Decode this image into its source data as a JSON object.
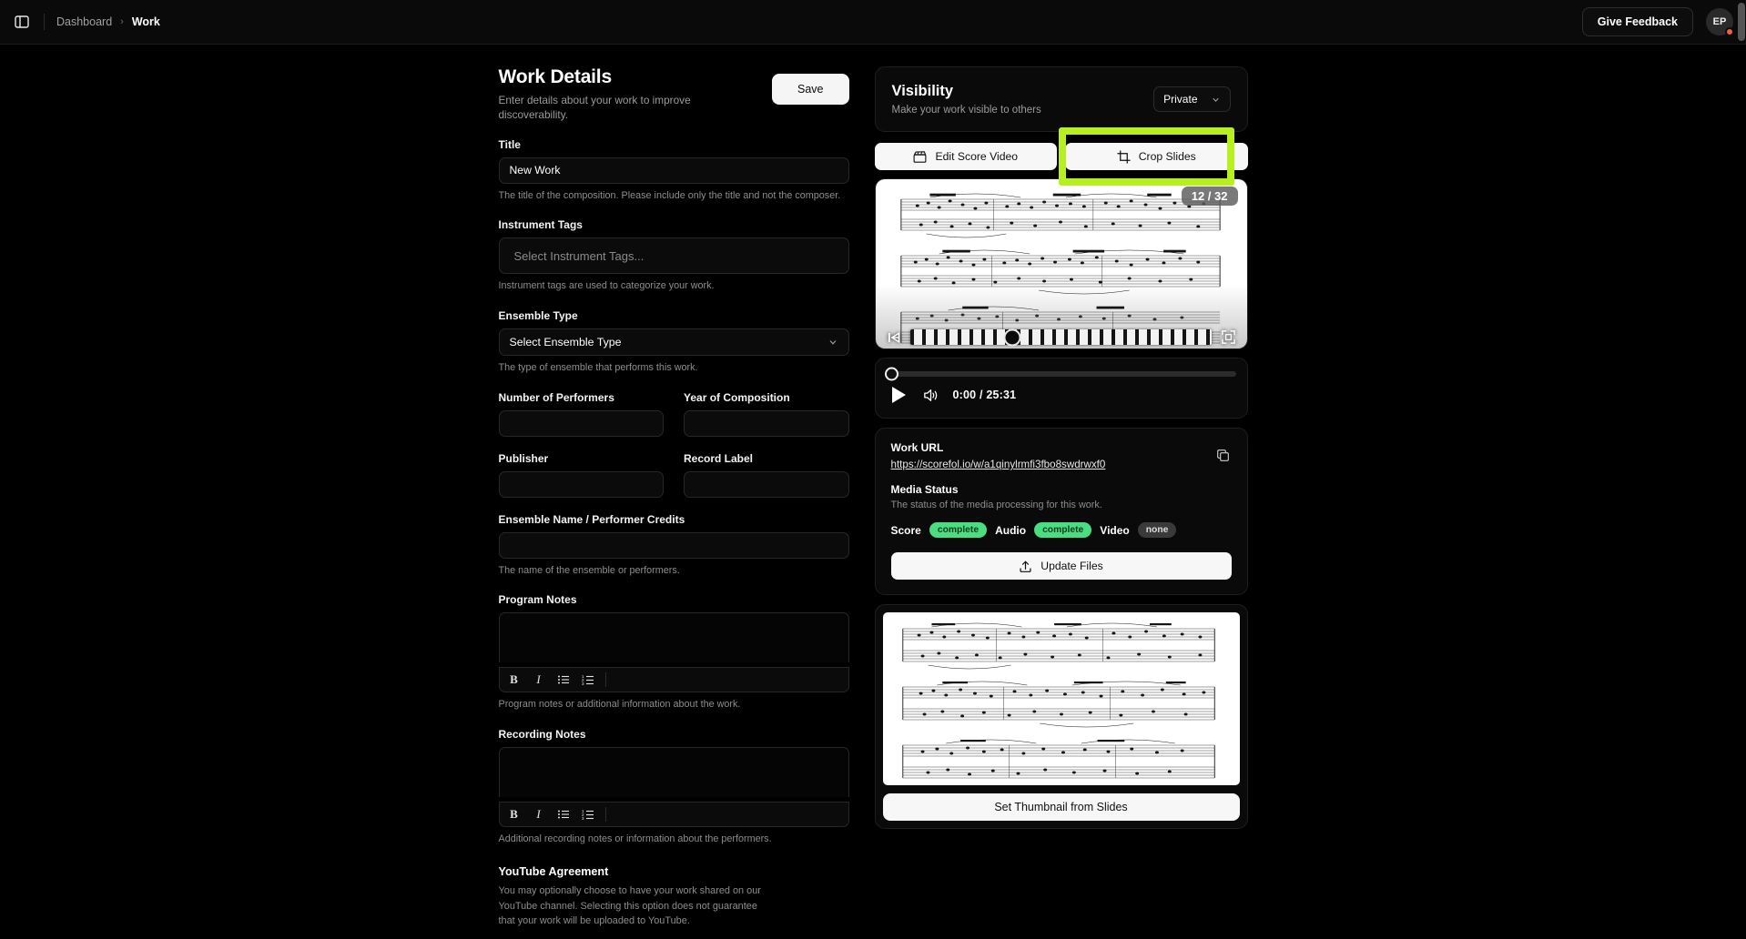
{
  "topbar": {
    "panel_toggle_icon": "sidebar-panel-icon",
    "breadcrumb": {
      "parent": "Dashboard",
      "separator": "›",
      "current": "Work"
    },
    "feedback_label": "Give Feedback",
    "avatar_initials": "EP"
  },
  "work_details": {
    "title": "Work Details",
    "subtitle": "Enter details about your work to improve discoverability.",
    "save_label": "Save",
    "fields": {
      "title": {
        "label": "Title",
        "value": "New Work",
        "help": "The title of the composition. Please include only the title and not the composer."
      },
      "instrument_tags": {
        "label": "Instrument Tags",
        "placeholder": "Select Instrument Tags...",
        "help": "Instrument tags are used to categorize your work."
      },
      "ensemble_type": {
        "label": "Ensemble Type",
        "value": "Select Ensemble Type",
        "help": "The type of ensemble that performs this work."
      },
      "number_of_performers": {
        "label": "Number of Performers",
        "value": ""
      },
      "year_of_composition": {
        "label": "Year of Composition",
        "value": ""
      },
      "publisher": {
        "label": "Publisher",
        "value": ""
      },
      "record_label": {
        "label": "Record Label",
        "value": ""
      },
      "ensemble_name": {
        "label": "Ensemble Name / Performer Credits",
        "value": "",
        "help": "The name of the ensemble or performers."
      },
      "program_notes": {
        "label": "Program Notes",
        "value": "",
        "help": "Program notes or additional information about the work."
      },
      "recording_notes": {
        "label": "Recording Notes",
        "value": "",
        "help": "Additional recording notes or information about the performers."
      }
    },
    "editor_toolbar": {
      "bold": "B",
      "italic": "I",
      "bullet_list": "bullet-list-icon",
      "ordered_list": "ordered-list-icon"
    },
    "youtube": {
      "title": "YouTube Agreement",
      "text": "You may optionally choose to have your work shared on our YouTube channel. Selecting this option does not guarantee that your work will be uploaded to YouTube."
    }
  },
  "visibility": {
    "title": "Visibility",
    "subtitle": "Make your work visible to others",
    "selected": "Private",
    "chevron": "⌄"
  },
  "tabs": {
    "edit_score_video": "Edit Score Video",
    "crop_slides": "Crop Slides",
    "highlight_color": "#b7f01e",
    "highlighted_tab": "Crop Slides"
  },
  "slide_viewer": {
    "counter": "12 / 32",
    "current_slide": 12,
    "total_slides": 32,
    "skip_start_icon": "skip-to-start-icon",
    "fullscreen_icon": "fullscreen-icon"
  },
  "audio_player": {
    "play_icon": "play-icon",
    "volume_icon": "volume-icon",
    "time": "0:00 / 25:31",
    "current_time": "0:00",
    "duration": "25:31",
    "progress_percent": 0
  },
  "work_info": {
    "url_label": "Work URL",
    "url": "https://scorefol.io/w/a1qinylrmfi3fbo8swdrwxf0",
    "copy_icon": "copy-icon",
    "media_status_label": "Media Status",
    "media_status_help": "The status of the media processing for this work.",
    "statuses": [
      {
        "name": "Score",
        "value": "complete",
        "color": "#4ade80"
      },
      {
        "name": "Audio",
        "value": "complete",
        "color": "#4ade80"
      },
      {
        "name": "Video",
        "value": "none",
        "color": "#3a3a3a"
      }
    ],
    "update_files_label": "Update Files",
    "upload_icon": "upload-icon"
  },
  "thumbnail": {
    "set_thumbnail_label": "Set Thumbnail from Slides"
  }
}
